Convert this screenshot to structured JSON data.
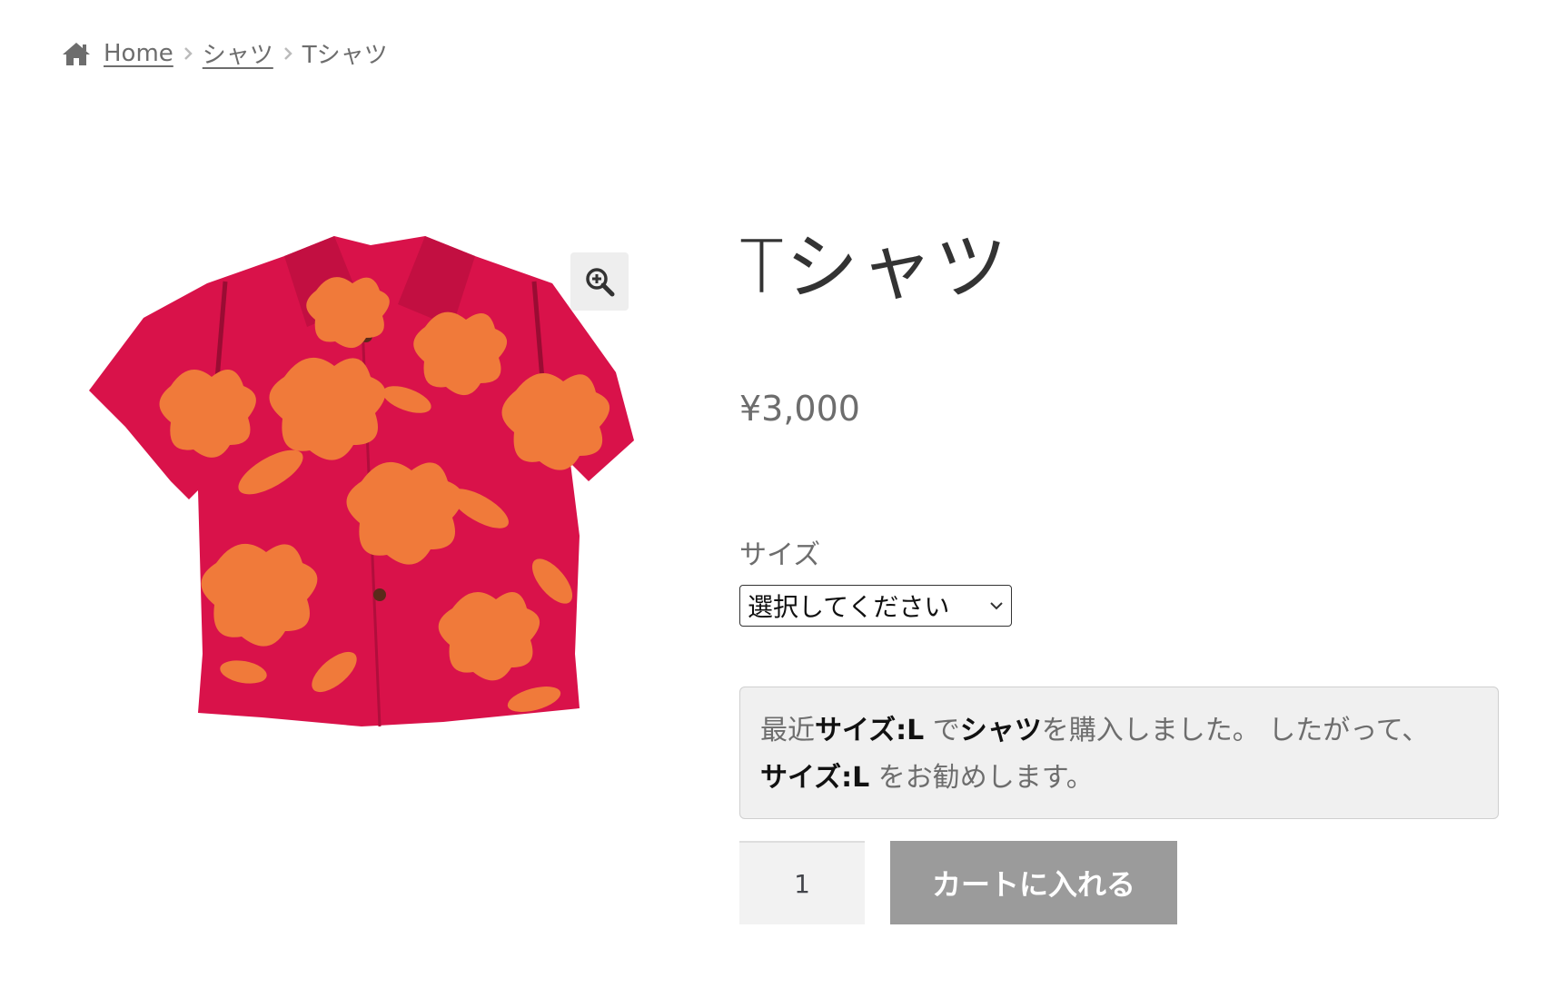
{
  "breadcrumb": {
    "home_label": "Home",
    "category_label": "シャツ",
    "current_label": "Tシャツ"
  },
  "product": {
    "title": "Tシャツ",
    "price": "¥3,000",
    "image_icon": "hawaiian-shirt-image"
  },
  "variation": {
    "label": "サイズ",
    "select_value": "選択してください"
  },
  "recommendation": {
    "prefix": "最近",
    "size_strong_1": "サイズ:L",
    "mid_1": " で",
    "product_strong": "シャツ",
    "mid_2": "を購入しました。 したがって、",
    "size_strong_2": "サイズ:L",
    "suffix": " をお勧めします。"
  },
  "cart": {
    "quantity": "1",
    "add_to_cart_label": "カートに入れる"
  },
  "colors": {
    "shirt_red": "#d9124a",
    "flower_orange": "#f07a3a",
    "button_gray": "#9b9b9b"
  }
}
